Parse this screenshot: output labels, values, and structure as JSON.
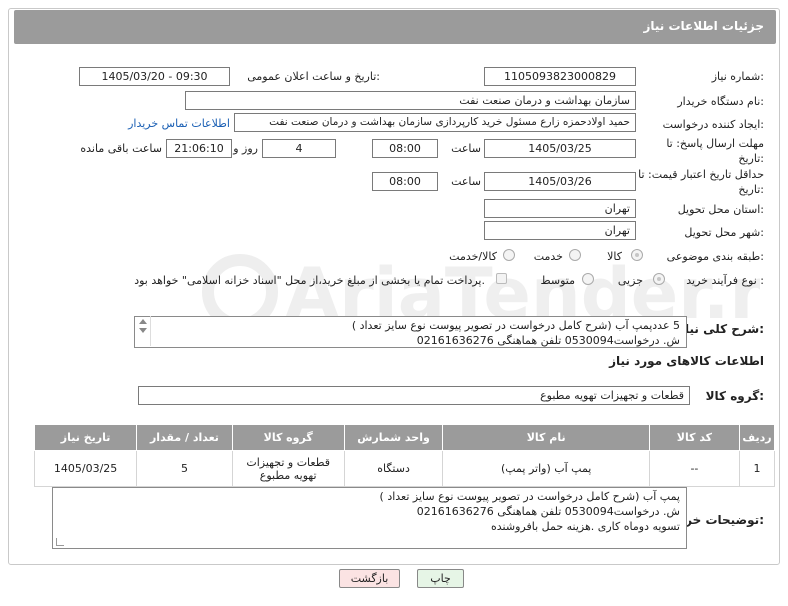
{
  "header": {
    "title": "جزئیات اطلاعات نیاز"
  },
  "form": {
    "need_number_label": "شماره نیاز:",
    "need_number": "1105093823000829",
    "announce_label": "تاریخ و ساعت اعلان عمومی:",
    "announce_value": "1405/03/20 - 09:30",
    "buyer_org_label": "نام دستگاه خریدار:",
    "buyer_org": "سازمان بهداشت و درمان صنعت نفت",
    "requester_label": "ایجاد کننده درخواست:",
    "requester": "حمید اولادحمزه زارع مسئول خرید کارپردازی سازمان بهداشت و درمان صنعت نفت",
    "contact_link": "اطلاعات تماس خریدار",
    "deadline_label": "مهلت ارسال پاسخ: تا تاریخ:",
    "deadline_date": "1405/03/25",
    "time_label": "ساعت",
    "deadline_time": "08:00",
    "days_value": "4",
    "days_label": "روز و",
    "remaining_time": "21:06:10",
    "remaining_label": "ساعت باقی مانده",
    "validity_label": "حداقل تاریخ اعتبار قیمت: تا تاریخ:",
    "validity_date": "1405/03/26",
    "validity_time": "08:00",
    "province_label": "استان محل تحویل:",
    "province": "تهران",
    "city_label": "شهر محل تحویل:",
    "city": "تهران",
    "category_label": "طبقه بندی موضوعی:",
    "category_options": [
      "کالا",
      "خدمت",
      "کالا/خدمت"
    ],
    "process_label": "نوع فرآیند خرید :",
    "process_options": [
      "جزیی",
      "متوسط"
    ],
    "payment_note": "پرداخت تمام یا بخشی از مبلغ خرید،از محل \"اسناد خزانه اسلامی\" خواهد بود."
  },
  "description": {
    "label": "شرح کلی نیاز:",
    "lines": [
      "5 عددپمپ آب (شرح کامل درخواست در تصویر پیوست نوع سایز تعداد )",
      "ش. درخواست0530094 تلفن هماهنگی 02161636276"
    ]
  },
  "goods": {
    "section_title": "اطلاعات کالاهای مورد نیاز",
    "group_label": "گروه کالا:",
    "group_value": "قطعات و تجهیزات تهویه مطبوع",
    "columns": [
      "ردیف",
      "کد کالا",
      "نام کالا",
      "واحد شمارش",
      "گروه کالا",
      "تعداد / مقدار",
      "تاریخ نیاز"
    ],
    "rows": [
      {
        "row": "1",
        "code": "--",
        "name": "پمپ آب (واتر پمپ)",
        "unit": "دستگاه",
        "group": "قطعات و تجهیزات تهویه مطبوع",
        "qty": "5",
        "date": "1405/03/25"
      }
    ]
  },
  "buyer_notes": {
    "label": "توضیحات خریدار:",
    "lines": [
      "پمپ آب (شرح کامل درخواست در تصویر پیوست نوع سایز تعداد )",
      "ش. درخواست0530094 تلفن هماهنگی 02161636276",
      "تسویه دوماه کاری .هزینه حمل بافروشنده"
    ]
  },
  "buttons": {
    "print": "چاپ",
    "back": "بازگشت"
  },
  "watermark": {
    "text": "AriaTender.neT"
  },
  "colors": {
    "header_bg": "#9b9b9b",
    "link": "#1a5fb4",
    "back_btn_bg": "#fbe3e3",
    "print_btn_bg": "#e6f5e6"
  }
}
